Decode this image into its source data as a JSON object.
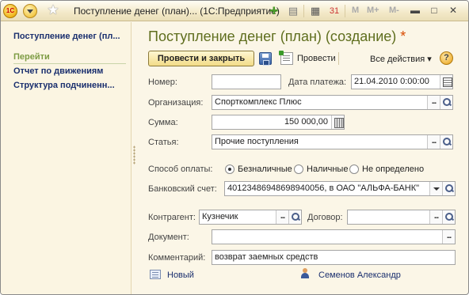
{
  "window": {
    "title": "Поступление денег (план)... (1С:Предприятие)",
    "logo_text": "1С",
    "toolbar_icons": [
      "add-favorite-icon",
      "history-icon",
      "calculator-icon",
      "calendar-icon"
    ],
    "memory_buttons": [
      "M",
      "M+",
      "M-"
    ],
    "controls": [
      "minimize-icon",
      "maximize-icon",
      "close-icon"
    ]
  },
  "sidebar": {
    "header": "Поступление денег (пл...",
    "section": "Перейти",
    "links": [
      "Отчет по движениям",
      "Структура подчиненн..."
    ]
  },
  "form": {
    "title": "Поступление денег (план) (создание)",
    "modified_mark": "*",
    "toolbar": {
      "post_and_close": "Провести и закрыть",
      "post": "Провести",
      "all_actions": "Все действия",
      "all_actions_arrow": "▾",
      "help": "?"
    },
    "fields": {
      "number": {
        "label": "Номер:",
        "value": ""
      },
      "payment_date": {
        "label": "Дата платежа:",
        "value": "21.04.2010  0:00:00"
      },
      "organization": {
        "label": "Организация:",
        "value": "Спорткомплекс Плюс"
      },
      "amount": {
        "label": "Сумма:",
        "value": "150 000,00"
      },
      "article": {
        "label": "Статья:",
        "value": "Прочие поступления"
      },
      "payment_method": {
        "label": "Способ оплаты:",
        "options": [
          "Безналичные",
          "Наличные",
          "Не определено"
        ],
        "selected": "Безналичные"
      },
      "bank_account": {
        "label": "Банковский счет:",
        "value": "40123486948698940056, в ОАО \"АЛЬФА-БАНК\""
      },
      "counterparty": {
        "label": "Контрагент:",
        "value": "Кузнечик"
      },
      "contract": {
        "label": "Договор:",
        "value": ""
      },
      "document": {
        "label": "Документ:",
        "value": ""
      },
      "comment": {
        "label": "Комментарий:",
        "value": "возврат заемных средств"
      }
    },
    "footer": {
      "status": "Новый",
      "author": "Семенов Александр"
    }
  },
  "colors": {
    "background": "#fbf6e7",
    "title_color": "#5f6e1e",
    "link_color": "#1a2f6e",
    "section_color": "#7d9c44",
    "modified_mark_color": "#d84a00"
  }
}
